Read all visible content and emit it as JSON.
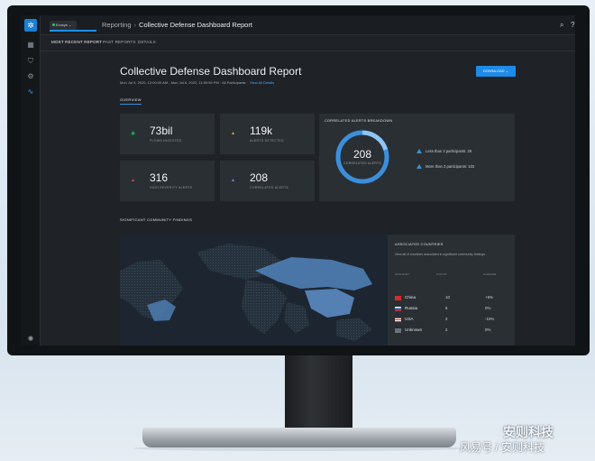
{
  "app": {
    "env_label": "Ecosys",
    "breadcrumb": {
      "root": "Reporting",
      "current": "Collective Defense Dashboard Report"
    }
  },
  "tabs": [
    "MOST RECENT REPORT",
    "PAST REPORTS",
    "DETAILS"
  ],
  "report": {
    "title": "Collective Defense Dashboard Report",
    "date_range": "Mon Jul 6, 2020, 12:00:00 AM - Mon Jul 6, 2022, 11:59:59 PM  ·  All Participants  ·",
    "view_all": "View All Details",
    "download_label": "DOWNLOAD  ⌄"
  },
  "overview": {
    "label": "OVERVIEW",
    "cards": [
      {
        "value": "73bil",
        "label": "FLOWS INGESTED",
        "icon": "flows-icon",
        "color": "#3fb07a"
      },
      {
        "value": "119k",
        "label": "ALERTS DETECTED",
        "icon": "alert-warning-icon",
        "color": "#f0a43a"
      },
      {
        "value": "316",
        "label": "HIGH SEVERITY ALERTS",
        "icon": "alert-high-icon",
        "color": "#e2504a"
      },
      {
        "value": "208",
        "label": "CORRELATED ALERTS",
        "icon": "alert-correlated-icon",
        "color": "#8a7be0"
      }
    ]
  },
  "correlated": {
    "title": "CORRELATED ALERTS BREAKDOWN",
    "total": "208",
    "total_label": "CORRELATED ALERTS",
    "segments": [
      {
        "label": "Less than 3 participants",
        "value": 26,
        "display": "Less than 3 participants: 26"
      },
      {
        "label": "More than 3 participants",
        "value": 103,
        "display": "More than 3 participants: 103"
      }
    ],
    "ring_color": "#3c8fd9",
    "ring_track": "#1e5c97"
  },
  "findings": {
    "label": "SIGNIFICANT COMMUNITY FINDINGS"
  },
  "countries": {
    "title": "ASSOCIATED COUNTRIES",
    "description": "View all of countries associated in significant community findings.",
    "headers": {
      "country": "COUNTRY",
      "count": "COUNT",
      "change": "CHANGE"
    },
    "rows": [
      {
        "name": "China",
        "count": "10",
        "change": "+5%"
      },
      {
        "name": "Russia",
        "count": "5",
        "change": "0%"
      },
      {
        "name": "USA",
        "count": "2",
        "change": "-10%"
      },
      {
        "name": "Unknown",
        "count": "2",
        "change": "0%"
      }
    ]
  },
  "watermark": {
    "brand": "安则科技",
    "source": "风易号 / 安则科技"
  }
}
